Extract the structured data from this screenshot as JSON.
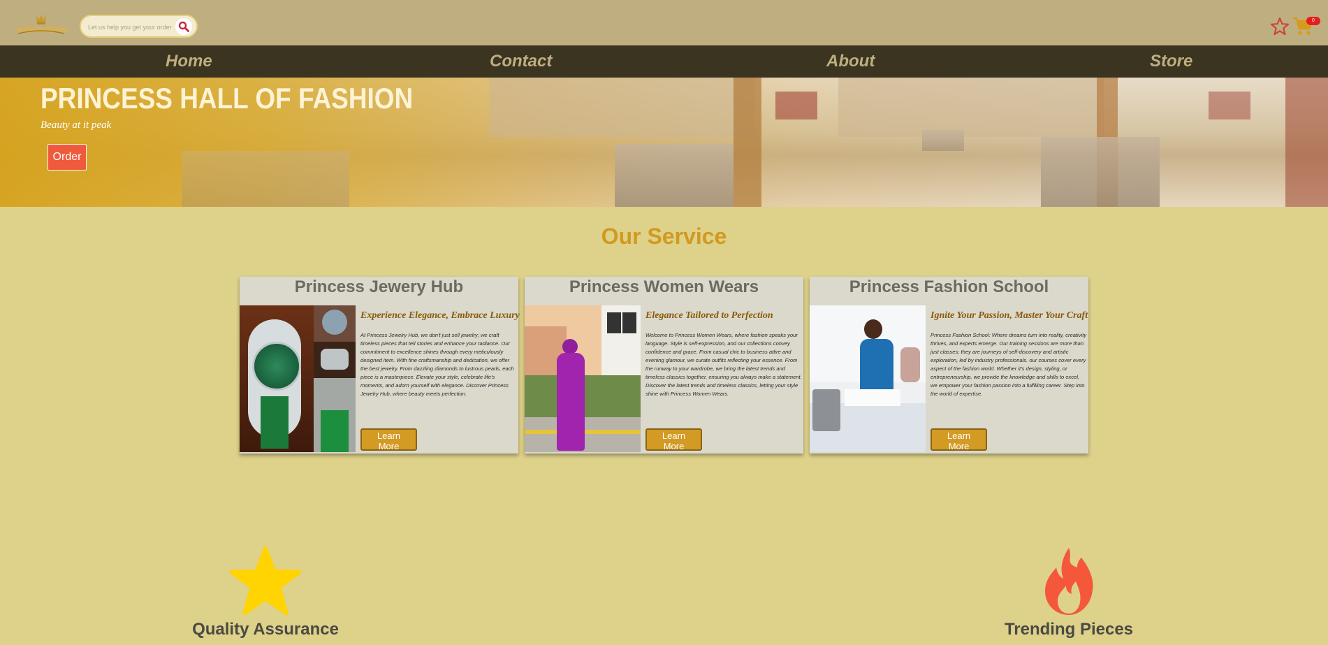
{
  "header": {
    "search_placeholder": "Let us help you get your order",
    "cart_count": "0"
  },
  "nav": {
    "items": [
      "Home",
      "Contact",
      "About",
      "Store"
    ]
  },
  "hero": {
    "title": "PRINCESS HALL OF FASHION",
    "subtitle": "Beauty at it peak",
    "order_label": "Order"
  },
  "services": {
    "title": "Our Service",
    "cards": [
      {
        "title": "Princess Jewery Hub",
        "tagline": "Experience Elegance, Embrace Luxury",
        "description": "At Princess Jewelry Hub, we don't just sell jewelry; we craft timeless pieces that tell stories and enhance your radiance. Our commitment to excellence shines through every meticulously designed item. With fine craftsmanship and dedication, we offer the best jewelry. From dazzling diamonds to lustrous pearls, each piece is a masterpiece. Elevate your style, celebrate life's moments, and adorn yourself with elegance. Discover Princess Jewelry Hub, where beauty meets perfection.",
        "button": "Learn More"
      },
      {
        "title": "Princess Women Wears",
        "tagline": "Elegance Tailored to Perfection",
        "description": "Welcome to Princess Women Wears, where fashion speaks your language. Style is self-expression, and our collections convey confidence and grace. From casual chic to business attire and evening glamour, we curate outfits reflecting your essence. From the runway to your wardrobe, we bring the latest trends and timeless classics together, ensuring you always make a statement. Discover the latest trends and timeless classics, letting your style shine with Princess Women Wears.",
        "button": "Learn More"
      },
      {
        "title": "Princess Fashion School",
        "tagline": "Ignite Your Passion, Master Your Craft",
        "description": "Princess Fashion School: Where dreams turn into reality, creativity thrives, and experts emerge. Our training sessions are more than just classes; they are journeys of self-discovery and artistic exploration, led by industry professionals. our courses cover every aspect of the fashion world. Whether it's design, styling, or entrepreneurship, we provide the knowledge and skills to excel, we empower your fashion passion into a fulfilling career. Step into the world of expertise.",
        "button": "Learn More"
      }
    ]
  },
  "features": [
    {
      "label": "Quality Assurance",
      "icon": "star-icon",
      "color": "#ffd400"
    },
    {
      "label": "Trending Pieces",
      "icon": "flame-icon",
      "color": "#f4573a"
    }
  ],
  "colors": {
    "topbar": "#bfae80",
    "nav": "#3a3420",
    "page": "#ded18a",
    "accent": "#d19a1f",
    "order": "#f05a3c"
  }
}
